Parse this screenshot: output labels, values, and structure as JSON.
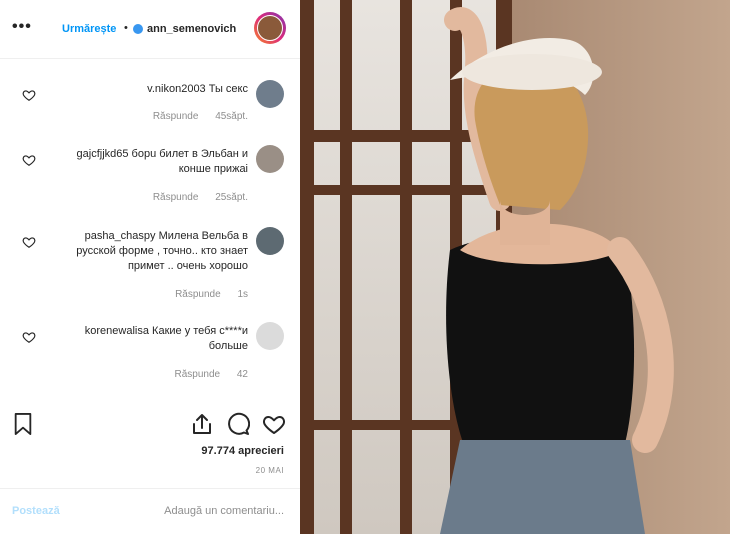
{
  "header": {
    "username": "ann_semenovich",
    "separator": "•",
    "follow_label": "Urmărește",
    "more_icon": "more-horizontal-icon",
    "verified_icon": "verified-badge-icon"
  },
  "comments": [
    {
      "text": "v.nikon2003 Ты секс",
      "time": "45săpt.",
      "reply": "Răspunde",
      "avatar_color": "#6f7d8c"
    },
    {
      "text": "gajcfjjkd65 борu билет в Эльбан и конше прижаi",
      "time": "25săpt.",
      "reply": "Răspunde",
      "avatar_color": "#9a8f86"
    },
    {
      "text": "pasha_chaspy Милена Вельба в русской форме , точно.. кто знает примет .. очень хорошо",
      "time": "1s",
      "reply": "Răspunde",
      "avatar_color": "#5d6a72"
    },
    {
      "text": "korenewalisa Какие у тебя с****и больше",
      "time": "42",
      "reply": "Răspunde",
      "avatar_color": "#dbdbdb"
    }
  ],
  "actions": {
    "like_icon": "heart-icon",
    "comment_icon": "comment-icon",
    "share_icon": "share-icon",
    "save_icon": "bookmark-icon"
  },
  "likes": "97.774 aprecieri",
  "date": "20 MAI",
  "composer": {
    "placeholder": "Adaugă un comentariu...",
    "post_label": "Postează"
  }
}
